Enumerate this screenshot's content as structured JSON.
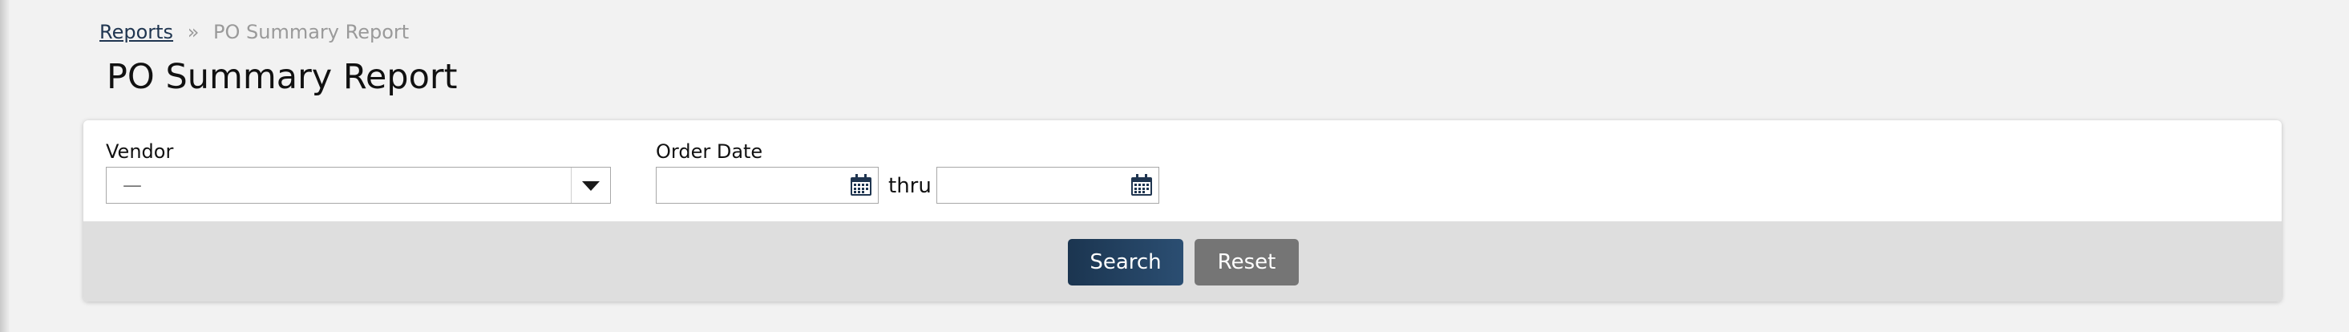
{
  "breadcrumb": {
    "link_label": "Reports",
    "separator": "»",
    "current": "PO Summary Report"
  },
  "page": {
    "title": "PO Summary Report"
  },
  "filters": {
    "vendor_label": "Vendor",
    "vendor_value": "—",
    "order_date_label": "Order Date",
    "date_from_value": "",
    "date_to_value": "",
    "range_separator": "thru"
  },
  "actions": {
    "search_label": "Search",
    "reset_label": "Reset"
  },
  "colors": {
    "primary_button": "#1b3550",
    "secondary_button": "#757575",
    "link": "#1f3550",
    "background": "#f2f2f2"
  },
  "icons": {
    "vendor_dropdown": "chevron-down-icon",
    "date_picker": "calendar-icon"
  }
}
